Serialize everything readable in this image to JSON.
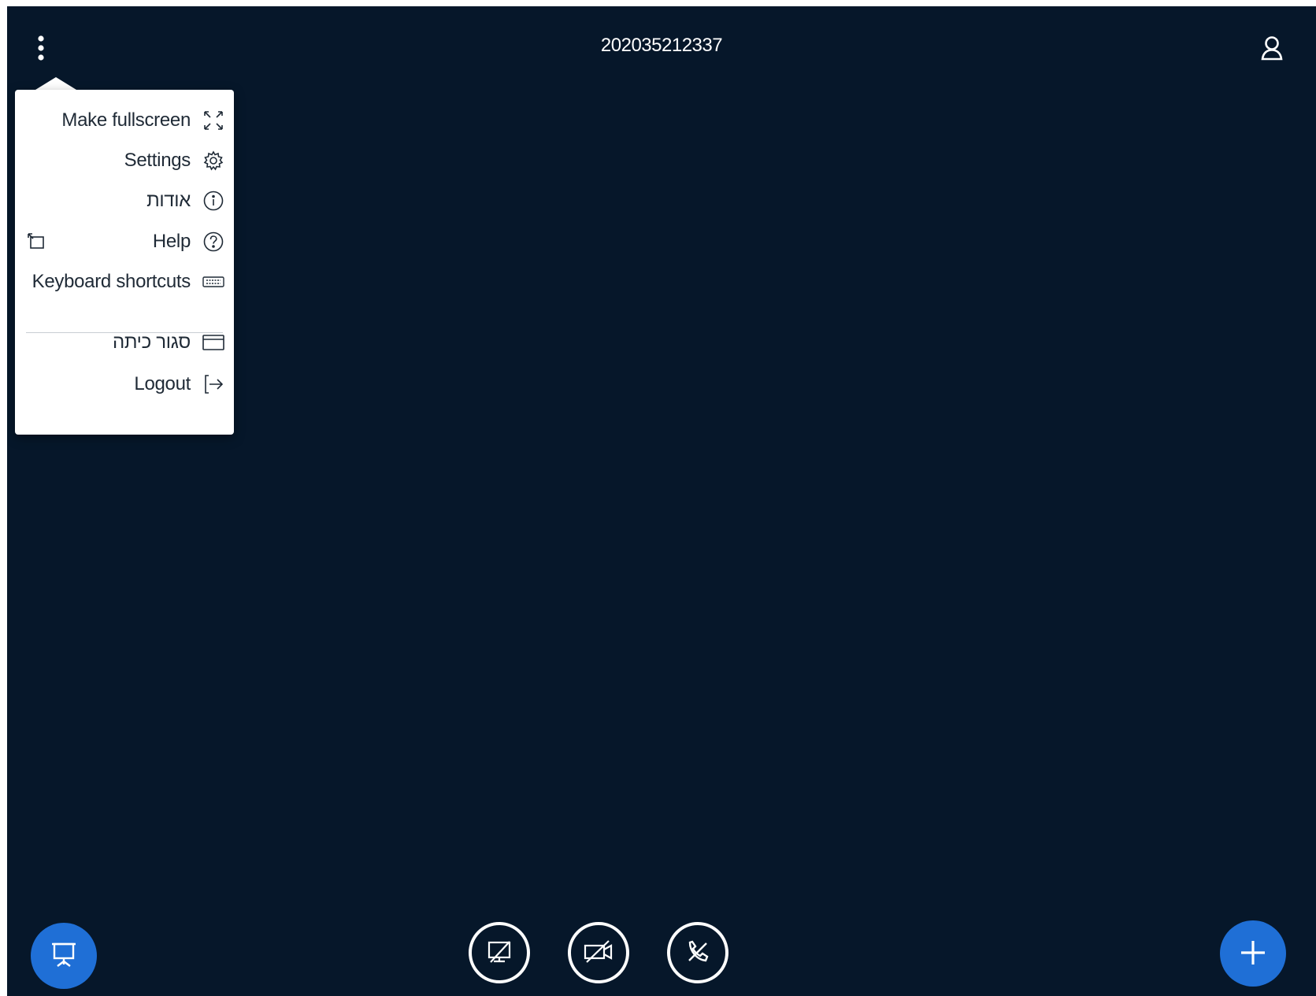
{
  "header": {
    "title": "202035212337",
    "menu_icon": "vertical-ellipsis-icon",
    "user_icon": "user-icon"
  },
  "options_menu": {
    "items": [
      {
        "label": "Make fullscreen",
        "icon": "fullscreen-icon"
      },
      {
        "label": "Settings",
        "icon": "gear-icon"
      },
      {
        "label": "אודות",
        "icon": "info-icon"
      },
      {
        "label": "Help",
        "icon": "help-icon",
        "extra_icon": "external-link-icon"
      },
      {
        "label": "Keyboard shortcuts",
        "icon": "keyboard-icon"
      },
      {
        "label": "סגור כיתה",
        "icon": "window-icon"
      },
      {
        "label": "Logout",
        "icon": "logout-icon"
      }
    ]
  },
  "bottom_bar": {
    "presentation_icon": "presentation-icon",
    "share_screen_icon": "screenshare-off-icon",
    "video_icon": "video-off-icon",
    "audio_icon": "phone-off-icon",
    "actions_icon": "plus-icon"
  },
  "colors": {
    "background": "#06172a",
    "accent_blue": "#1f6fd6",
    "menu_bg": "#ffffff",
    "menu_text": "#1f2a36"
  }
}
